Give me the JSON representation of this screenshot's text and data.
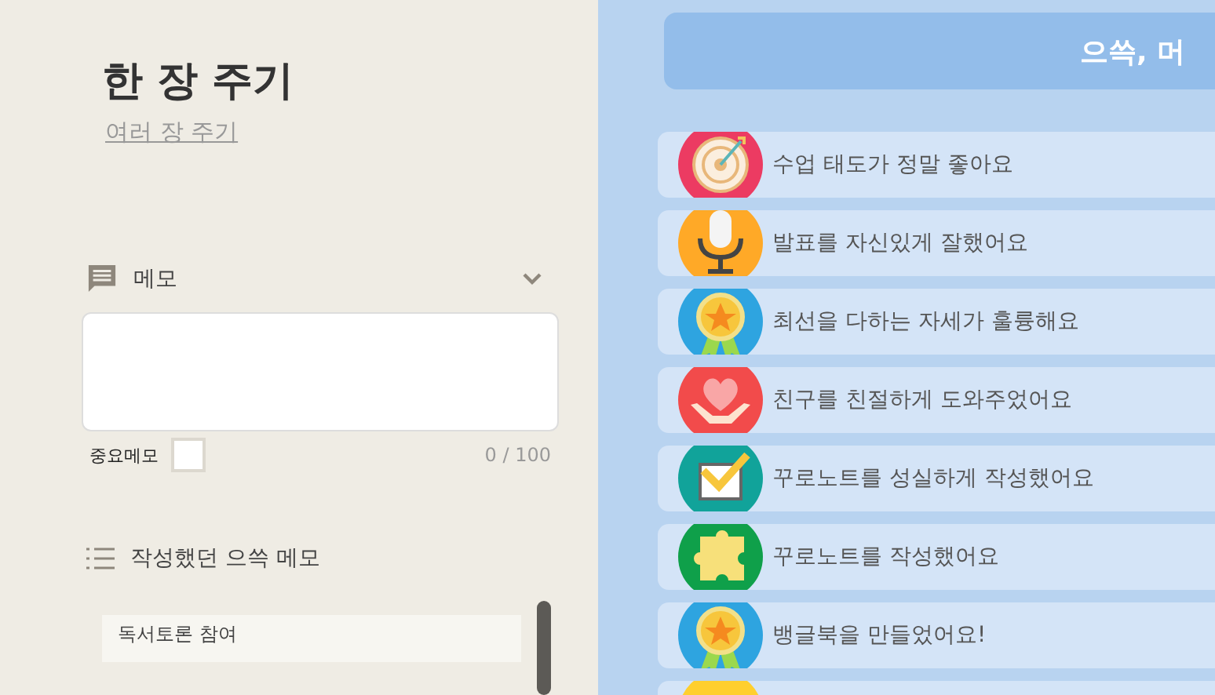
{
  "left_panel": {
    "title": "한 장 주기",
    "link": "여러 장 주기",
    "memo": {
      "label": "메모",
      "expanded": true,
      "important_label": "중요메모",
      "important_checked": false,
      "counter": "0 / 100"
    },
    "history": {
      "label": "작성했던 으쓱 메모",
      "items": [
        {
          "text": "독서토론 참여"
        }
      ]
    }
  },
  "right_panel": {
    "header": "으쓱, 머",
    "items": [
      {
        "kind": "target",
        "label": "수업 태도가 정말 좋아요"
      },
      {
        "kind": "mic",
        "label": "발표를 자신있게 잘했어요"
      },
      {
        "kind": "medal",
        "label": "최선을 다하는 자세가 훌륭해요"
      },
      {
        "kind": "heart",
        "label": "친구를 친절하게 도와주었어요"
      },
      {
        "kind": "check",
        "label": "꾸로노트를 성실하게 작성했어요"
      },
      {
        "kind": "puzzle",
        "label": "꾸로노트를 작성했어요"
      },
      {
        "kind": "medal",
        "label": "뱅글북을 만들었어요!"
      },
      {
        "kind": "sun"
      }
    ]
  }
}
